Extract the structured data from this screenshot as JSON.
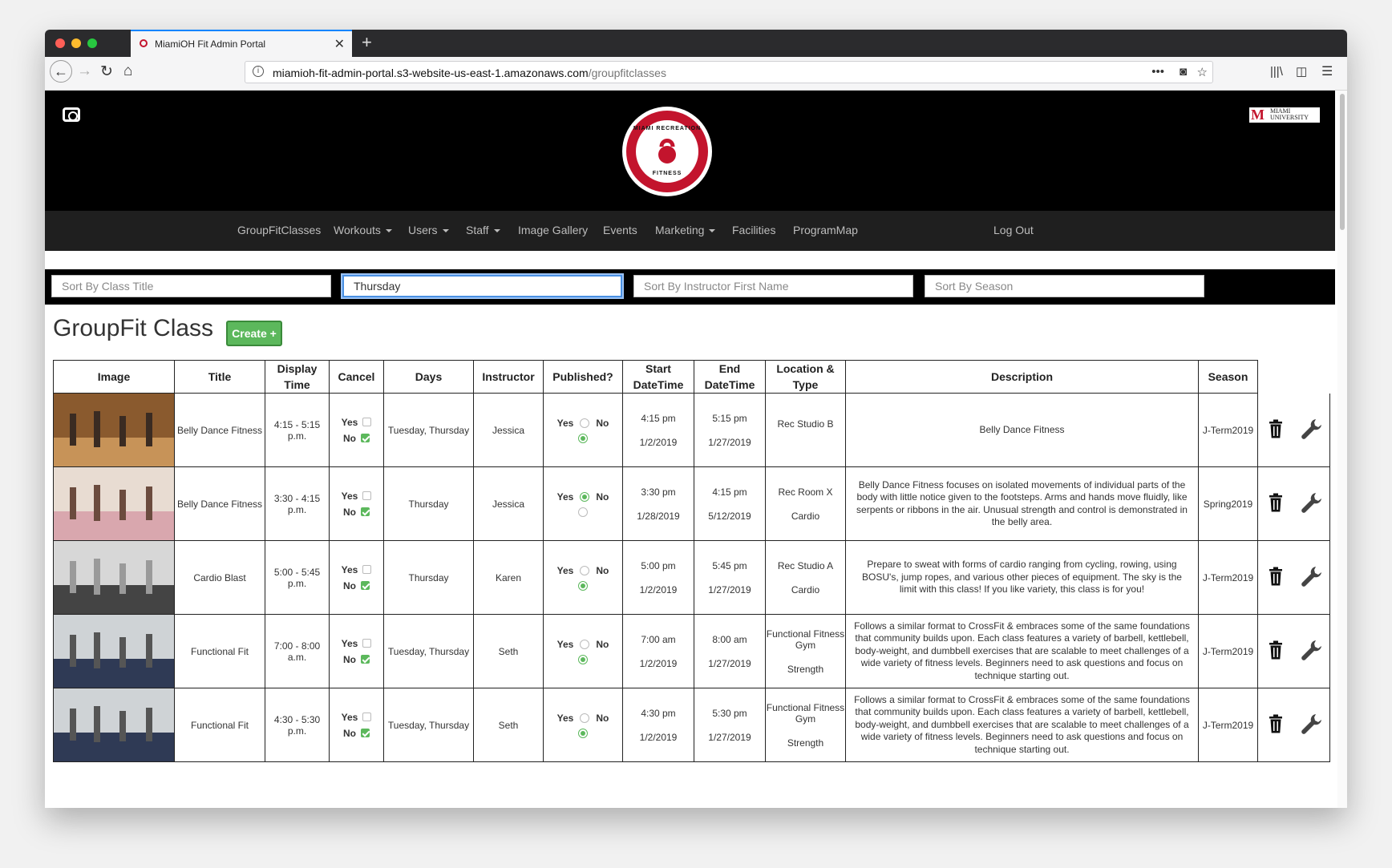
{
  "browser": {
    "tab_title": "MiamiOH Fit Admin Portal",
    "url_host": "miamioh-fit-admin-portal.s3-website-us-east-1.amazonaws.com",
    "url_path": "/groupfitclasses"
  },
  "header": {
    "logo_text_top": "MIAMI RECREATION",
    "logo_text_bottom": "FITNESS",
    "university_mark": "M",
    "university_name_1": "MIAMI",
    "university_name_2": "UNIVERSITY"
  },
  "nav": {
    "items": [
      "GroupFitClasses",
      "Workouts",
      "Users",
      "Staff",
      "Image Gallery",
      "Events",
      "Marketing",
      "Facilities",
      "ProgramMap"
    ],
    "logout": "Log Out"
  },
  "filters": {
    "title_placeholder": "Sort By Class Title",
    "day_value": "Thursday",
    "instructor_placeholder": "Sort By Instructor First Name",
    "season_placeholder": "Sort By Season"
  },
  "page": {
    "title": "GroupFit Class",
    "create_label": "Create +"
  },
  "table": {
    "headers": [
      "Image",
      "Title",
      "Display Time",
      "Cancel",
      "Days",
      "Instructor",
      "Published?",
      "Start DateTime",
      "End DateTime",
      "Location & Type",
      "Description",
      "Season"
    ],
    "yes_label": "Yes",
    "no_label": "No",
    "rows": [
      {
        "title": "Belly Dance Fitness",
        "display_time": "4:15 - 5:15 p.m.",
        "cancel": "No",
        "days": "Tuesday, Thursday",
        "instructor": "Jessica",
        "published": "No",
        "start_time": "4:15 pm",
        "start_date": "1/2/2019",
        "end_time": "5:15 pm",
        "end_date": "1/27/2019",
        "location": "Rec Studio B",
        "type": "",
        "description": "Belly Dance Fitness",
        "season": "J-Term2019",
        "photo_colors": [
          "#8a5a2e",
          "#c79358",
          "#3a2b22"
        ]
      },
      {
        "title": "Belly Dance Fitness",
        "display_time": "3:30 - 4:15 p.m.",
        "cancel": "No",
        "days": "Thursday",
        "instructor": "Jessica",
        "published": "Yes",
        "start_time": "3:30 pm",
        "start_date": "1/28/2019",
        "end_time": "4:15 pm",
        "end_date": "5/12/2019",
        "location": "Rec Room X",
        "type": "Cardio",
        "description": "Belly Dance Fitness focuses on isolated movements of individual parts of the body with little notice given to the footsteps. Arms and hands move fluidly, like serpents or ribbons in the air. Unusual strength and control is demonstrated in the belly area.",
        "season": "Spring2019",
        "photo_colors": [
          "#e8dcd2",
          "#d9a7ae",
          "#6b4b3e"
        ]
      },
      {
        "title": "Cardio Blast",
        "display_time": "5:00 - 5:45 p.m.",
        "cancel": "No",
        "days": "Thursday",
        "instructor": "Karen",
        "published": "No",
        "start_time": "5:00 pm",
        "start_date": "1/2/2019",
        "end_time": "5:45 pm",
        "end_date": "1/27/2019",
        "location": "Rec Studio A",
        "type": "Cardio",
        "description": "Prepare to sweat with forms of cardio ranging from cycling, rowing, using BOSU's, jump ropes, and various other pieces of equipment. The sky is the limit with this class! If you like variety, this class is for you!",
        "season": "J-Term2019",
        "photo_colors": [
          "#d7d7d7",
          "#444444",
          "#9a9a9a"
        ]
      },
      {
        "title": "Functional Fit",
        "display_time": "7:00 - 8:00 a.m.",
        "cancel": "No",
        "days": "Tuesday, Thursday",
        "instructor": "Seth",
        "published": "No",
        "start_time": "7:00 am",
        "start_date": "1/2/2019",
        "end_time": "8:00 am",
        "end_date": "1/27/2019",
        "location": "Functional Fitness Gym",
        "type": "Strength",
        "description": "Follows a similar format to CrossFit & embraces some of the same foundations that community builds upon. Each class features a variety of barbell, kettlebell, body-weight, and dumbbell exercises that are scalable to meet challenges of a wide variety of fitness levels. Beginners need to ask questions and focus on technique starting out.",
        "season": "J-Term2019",
        "photo_colors": [
          "#cfd3d6",
          "#2f3a55",
          "#555"
        ]
      },
      {
        "title": "Functional Fit",
        "display_time": "4:30 - 5:30 p.m.",
        "cancel": "No",
        "days": "Tuesday, Thursday",
        "instructor": "Seth",
        "published": "No",
        "start_time": "4:30 pm",
        "start_date": "1/2/2019",
        "end_time": "5:30 pm",
        "end_date": "1/27/2019",
        "location": "Functional Fitness Gym",
        "type": "Strength",
        "description": "Follows a similar format to CrossFit & embraces some of the same foundations that community builds upon. Each class features a variety of barbell, kettlebell, body-weight, and dumbbell exercises that are scalable to meet challenges of a wide variety of fitness levels. Beginners need to ask questions and focus on technique starting out.",
        "season": "J-Term2019",
        "photo_colors": [
          "#cfd3d6",
          "#2f3a55",
          "#555"
        ]
      }
    ]
  },
  "colors": {
    "accent": "#c3142d",
    "create": "#5cb85c",
    "menu_bg": "#1f1f1f"
  }
}
